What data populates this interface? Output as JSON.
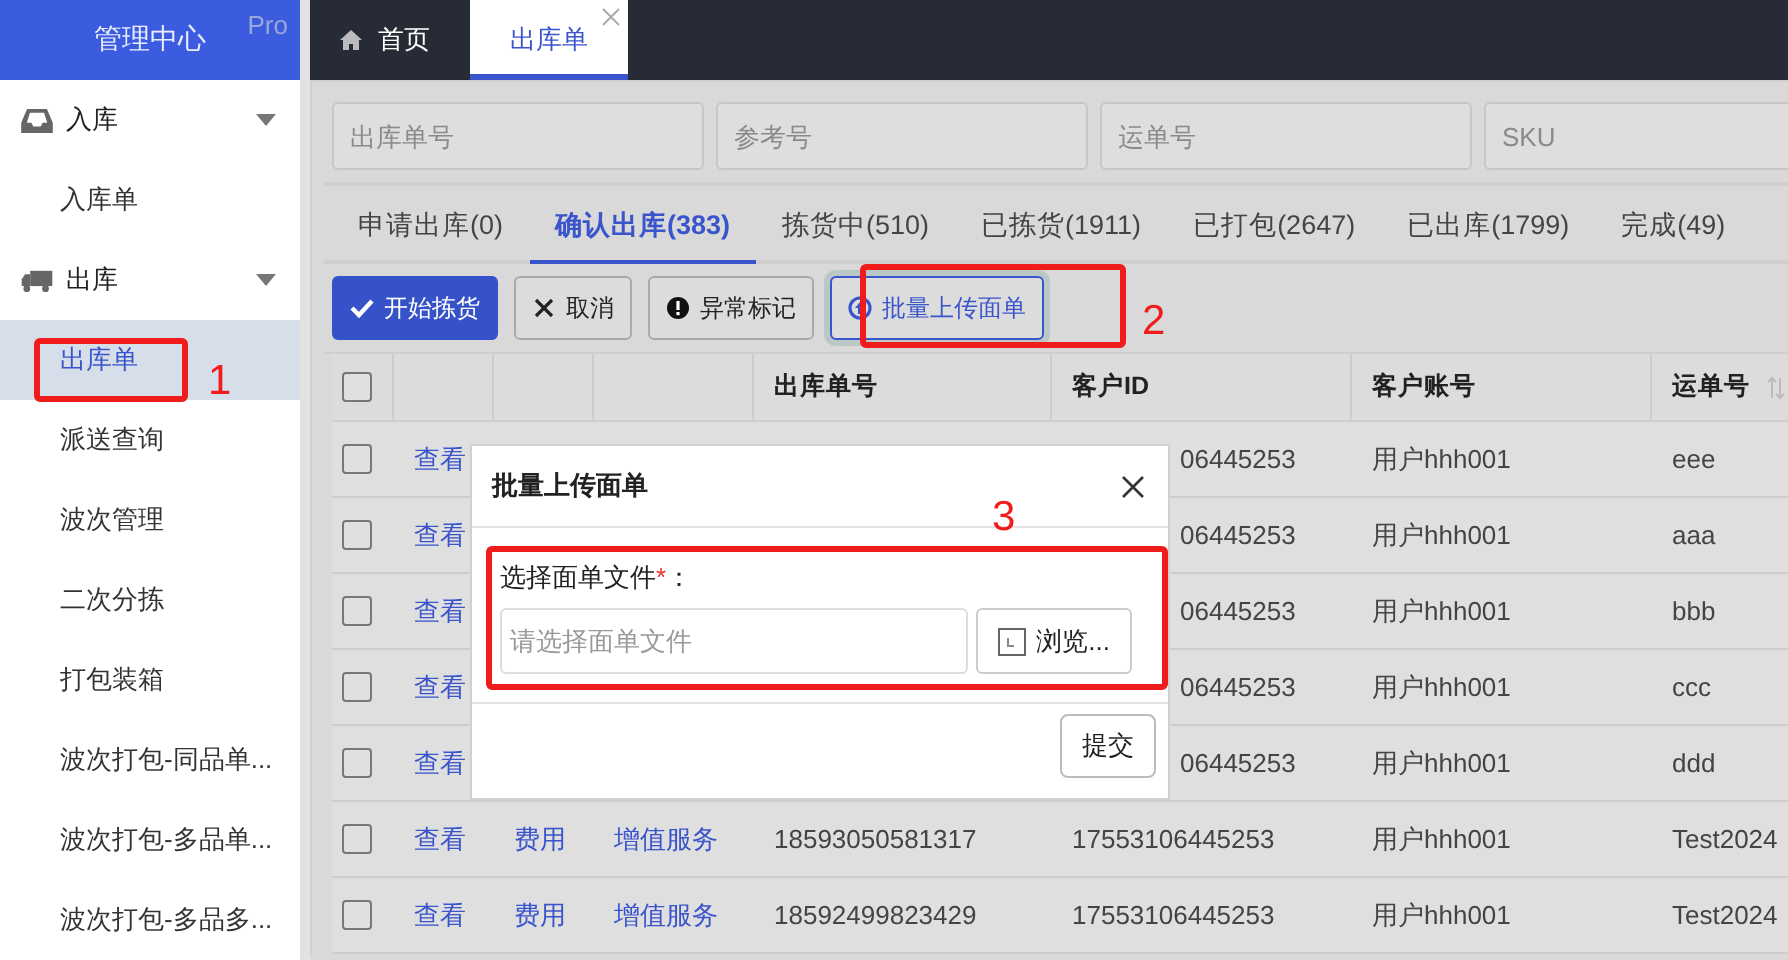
{
  "sidebar": {
    "title": "管理中心",
    "badge": "Pro",
    "groups": [
      {
        "label": "入库",
        "expanded": true,
        "children": [
          {
            "label": "入库单",
            "selected": false
          }
        ]
      },
      {
        "label": "出库",
        "expanded": true,
        "children": [
          {
            "label": "出库单",
            "selected": true
          },
          {
            "label": "派送查询",
            "selected": false
          },
          {
            "label": "波次管理",
            "selected": false
          },
          {
            "label": "二次分拣",
            "selected": false
          },
          {
            "label": "打包装箱",
            "selected": false
          },
          {
            "label": "波次打包-同品单...",
            "selected": false
          },
          {
            "label": "波次打包-多品单...",
            "selected": false
          },
          {
            "label": "波次打包-多品多...",
            "selected": false
          }
        ]
      }
    ]
  },
  "page_tabs": [
    {
      "label": "首页",
      "selected": false,
      "closable": false
    },
    {
      "label": "出库单",
      "selected": true,
      "closable": true
    }
  ],
  "filters": [
    {
      "placeholder": "出库单号"
    },
    {
      "placeholder": "参考号"
    },
    {
      "placeholder": "运单号"
    },
    {
      "placeholder": "SKU"
    }
  ],
  "status_tabs": [
    {
      "label": "申请出库(0)",
      "selected": false
    },
    {
      "label": "确认出库(383)",
      "selected": true
    },
    {
      "label": "拣货中(510)",
      "selected": false
    },
    {
      "label": "已拣货(1911)",
      "selected": false
    },
    {
      "label": "已打包(2647)",
      "selected": false
    },
    {
      "label": "已出库(1799)",
      "selected": false
    },
    {
      "label": "完成(49)",
      "selected": false
    }
  ],
  "actions": [
    {
      "label": "开始拣货",
      "kind": "primary"
    },
    {
      "label": "取消",
      "kind": "default"
    },
    {
      "label": "异常标记",
      "kind": "default"
    },
    {
      "label": "批量上传面单",
      "kind": "focused"
    }
  ],
  "table": {
    "all_checked": false,
    "columns": [
      {
        "label": "出库单号",
        "sortable": false
      },
      {
        "label": "客户ID",
        "sortable": false
      },
      {
        "label": "客户账号",
        "sortable": false
      },
      {
        "label": "运单号",
        "sortable": true
      }
    ],
    "rows": [
      {
        "kind": "covered",
        "checked": false,
        "view": "查看",
        "customer_id": "06445253",
        "account": "用户hhh001",
        "waybill": "eee"
      },
      {
        "kind": "covered",
        "checked": false,
        "view": "查看",
        "customer_id": "06445253",
        "account": "用户hhh001",
        "waybill": "aaa"
      },
      {
        "kind": "covered",
        "checked": false,
        "view": "查看",
        "customer_id": "06445253",
        "account": "用户hhh001",
        "waybill": "bbb"
      },
      {
        "kind": "covered",
        "checked": false,
        "view": "查看",
        "customer_id": "06445253",
        "account": "用户hhh001",
        "waybill": "ccc"
      },
      {
        "kind": "covered",
        "checked": false,
        "view": "查看",
        "customer_id": "06445253",
        "account": "用户hhh001",
        "waybill": "ddd"
      },
      {
        "kind": "full",
        "checked": false,
        "view": "查看",
        "fee": "费用",
        "service": "增值服务",
        "order_no": "18593050581317",
        "customer_id": "17553106445253",
        "account": "用户hhh001",
        "waybill": "Test2024"
      },
      {
        "kind": "full",
        "checked": false,
        "view": "查看",
        "fee": "费用",
        "service": "增值服务",
        "order_no": "18592499823429",
        "customer_id": "17553106445253",
        "account": "用户hhh001",
        "waybill": "Test2024"
      }
    ]
  },
  "modal": {
    "title": "批量上传面单",
    "field_label": "选择面单文件",
    "required_mark": "*",
    "label_suffix": "：",
    "placeholder": "请选择面单文件",
    "browse": "浏览...",
    "submit": "提交"
  },
  "annotations": [
    {
      "label": "1"
    },
    {
      "label": "2"
    },
    {
      "label": "3"
    }
  ]
}
